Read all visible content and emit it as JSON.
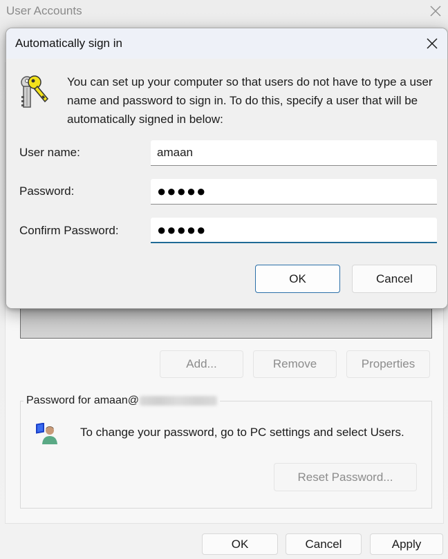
{
  "parent_window": {
    "title": "User Accounts",
    "close_icon": "close-icon",
    "list_buttons": {
      "add": "Add...",
      "remove": "Remove",
      "properties": "Properties"
    },
    "password_group": {
      "legend_prefix": "Password for amaan@",
      "legend_domain_redacted": true,
      "icon": "user-with-monitor-icon",
      "info_text": "To change your password, go to PC settings and select Users.",
      "reset_button": "Reset Password..."
    },
    "footer_buttons": {
      "ok": "OK",
      "cancel": "Cancel",
      "apply": "Apply"
    }
  },
  "dialog": {
    "title": "Automatically sign in",
    "close_icon": "close-icon",
    "icon": "keys-icon",
    "description": "You can set up your computer so that users do not have to type a user name and password to sign in. To do this, specify a user that will be automatically signed in below:",
    "fields": [
      {
        "label": "User name:",
        "value": "amaan",
        "type": "text"
      },
      {
        "label": "Password:",
        "value": "●●●●●",
        "type": "password"
      },
      {
        "label": "Confirm Password:",
        "value": "●●●●●",
        "type": "password",
        "focused": true
      }
    ],
    "buttons": {
      "ok": "OK",
      "cancel": "Cancel"
    }
  },
  "colors": {
    "accent": "#1f6a96",
    "default_button_border": "#2a6fa8",
    "dialog_titlebar": "#eef1f8",
    "disabled_text": "#8c8c8c"
  }
}
